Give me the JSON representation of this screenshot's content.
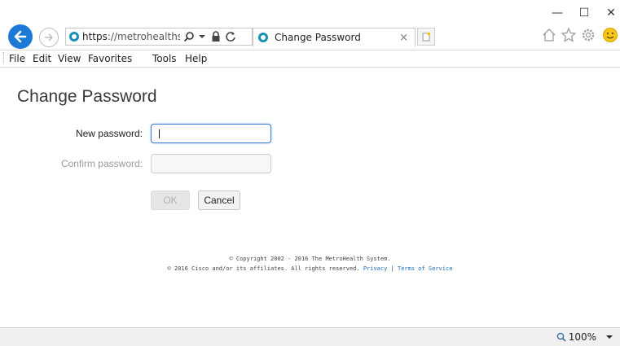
{
  "window": {
    "minimize_glyph": "—",
    "maximize_glyph": "☐",
    "close_glyph": "✕"
  },
  "browser": {
    "address_prefix": "https",
    "address_rest": "://metrohealths...",
    "tab_title": "Change Password",
    "tab_close_glyph": "×",
    "menu": [
      "File",
      "Edit",
      "View",
      "Favorites",
      "Tools",
      "Help"
    ],
    "zoom": "100%"
  },
  "page": {
    "title": "Change Password",
    "new_password_label": "New password:",
    "confirm_password_label": "Confirm password:",
    "new_password_value": "",
    "confirm_password_value": "",
    "ok_label": "OK",
    "cancel_label": "Cancel"
  },
  "footer": {
    "line1": "© Copyright 2002 - 2016 The MetroHealth System.",
    "line2_text": "© 2016 Cisco and/or its affiliates. All rights reserved.",
    "privacy": "Privacy",
    "separator": "|",
    "terms": "Terms of Service"
  },
  "colors": {
    "accent_blue": "#1c7ad6",
    "input_focus": "#3b82d6",
    "link": "#1f6fbf"
  }
}
